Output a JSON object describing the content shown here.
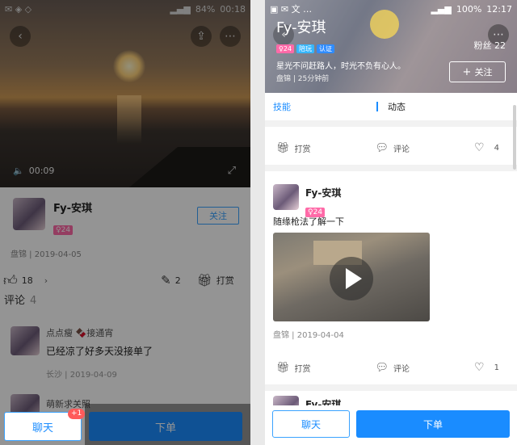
{
  "left": {
    "status": {
      "time": "00:18",
      "battery": "84%"
    },
    "video": {
      "duration": "00:09"
    },
    "profile": {
      "name": "Fy-安琪",
      "badge": "♀24",
      "follow": "关注",
      "meta": "盘锦 | 2019-04-05"
    },
    "actions": {
      "likes": "18",
      "edits": "2",
      "reward": "打赏"
    },
    "comments": {
      "label": "评论",
      "count": "4",
      "items": [
        {
          "name": "点点瘦 🍫接通宵",
          "text": "已经凉了好多天没接单了",
          "meta": "长沙 | 2019-04-09"
        },
        {
          "name": "萌新求关照"
        }
      ]
    },
    "bottom": {
      "chat": "聊天",
      "chat_badge": "+1",
      "order": "下单"
    }
  },
  "right": {
    "status": {
      "time": "12:17",
      "battery": "100%"
    },
    "hero": {
      "name": "Fy-安琪",
      "badges": [
        "♀24",
        "陪玩",
        "认证"
      ],
      "signature": "星光不问赶路人，时光不负有心人。",
      "meta": "盘锦 | 25分钟前",
      "fans_label": "粉丝",
      "fans": "22",
      "follow": "关注"
    },
    "tabs": [
      "技能",
      "动态"
    ],
    "top_actions": {
      "reward": "打赏",
      "comment": "评论",
      "likes": "4"
    },
    "post": {
      "name": "Fy-安琪",
      "badge": "♀24",
      "text": "随缘枪法了解一下",
      "meta": "盘锦 | 2019-04-04",
      "reward": "打赏",
      "comment": "评论",
      "likes": "1"
    },
    "next_post": {
      "name": "Fy-安琪"
    },
    "bottom": {
      "chat": "聊天",
      "order": "下单"
    }
  },
  "colors": {
    "accent": "#1a8cff",
    "pink": "#ff6aa8"
  }
}
